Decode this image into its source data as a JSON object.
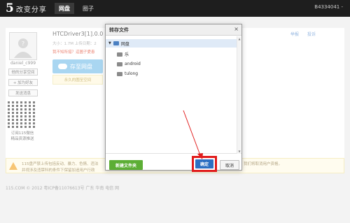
{
  "topbar": {
    "logo_mark": "5",
    "logo_text": "改变分享",
    "tabs": [
      {
        "label": "网盘"
      },
      {
        "label": "圈子"
      }
    ],
    "user_id": "B4334041 -"
  },
  "sidebar": {
    "username": "daniel_c999",
    "space_button": "他的分享空间",
    "add_friend_button": "+ 加为好友",
    "message_button": "发送消息",
    "qr_caption_1": "订阅115微信",
    "qr_caption_2": "精品资源推送"
  },
  "file": {
    "title": "HTCDriver3[1].0.0",
    "meta": "大小：1.7M  上传日期：2",
    "warn": "我不知所措？這圖子愛患",
    "save_button": "存至网盘",
    "save_sub": "永久的圍至空间"
  },
  "report_links": [
    "举报",
    "投诉"
  ],
  "notice": {
    "line1": "115盘严禁上传包括反动、暴力、色情、违法",
    "line1_right": "对于涉嫌上传违法作品的用户，我们将取消用户资格，",
    "line2": "并视涉及违禁科的条件下保留加追用户行政"
  },
  "footer": "115.COM © 2012 粤ICP备11076613号 广东 华南 电信 网",
  "dialog": {
    "title": "转存文件",
    "close_symbol": "×",
    "root_label": "网盘",
    "folders": [
      {
        "label": "乐"
      },
      {
        "label": "android"
      },
      {
        "label": "tulong"
      }
    ],
    "new_folder_button": "新建文件夹",
    "confirm_button": "确定",
    "cancel_button": "取消"
  },
  "colors": {
    "annotation_red": "#e11b1b",
    "confirm_blue": "#2d6fc2",
    "new_folder_green": "#5cae35"
  }
}
